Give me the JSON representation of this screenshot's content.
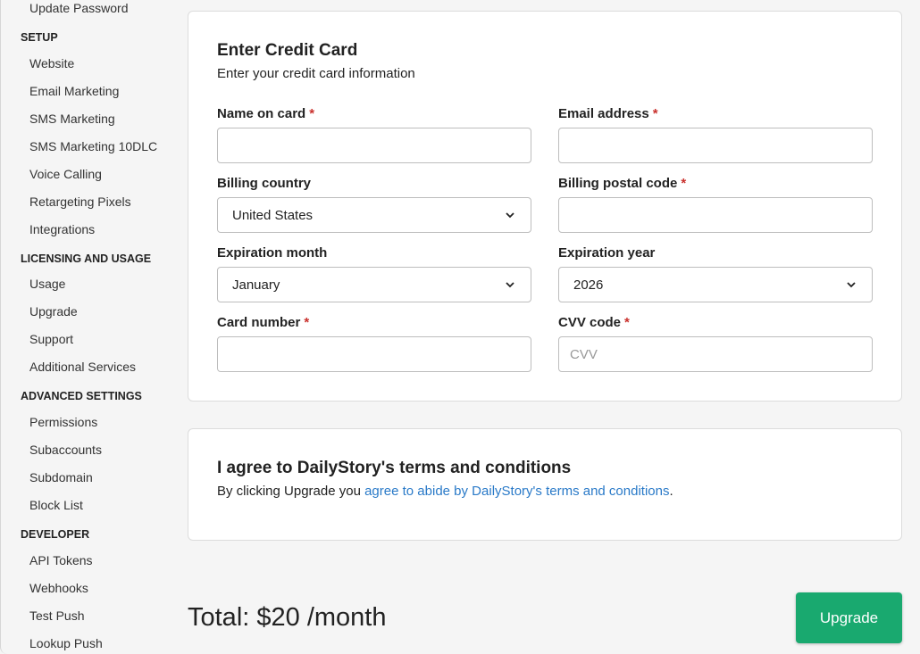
{
  "sidebar": {
    "top_item": "Update Password",
    "sections": [
      {
        "title": "SETUP",
        "items": [
          "Website",
          "Email Marketing",
          "SMS Marketing",
          "SMS Marketing 10DLC",
          "Voice Calling",
          "Retargeting Pixels",
          "Integrations"
        ]
      },
      {
        "title": "LICENSING AND USAGE",
        "items": [
          "Usage",
          "Upgrade",
          "Support",
          "Additional Services"
        ]
      },
      {
        "title": "ADVANCED SETTINGS",
        "items": [
          "Permissions",
          "Subaccounts",
          "Subdomain",
          "Block List"
        ]
      },
      {
        "title": "DEVELOPER",
        "items": [
          "API Tokens",
          "Webhooks",
          "Test Push",
          "Lookup Push"
        ]
      }
    ]
  },
  "credit_card": {
    "title": "Enter Credit Card",
    "subtitle": "Enter your credit card information",
    "required_mark": "*",
    "name_label": "Name on card",
    "name_value": "",
    "email_label": "Email address",
    "email_value": "",
    "country_label": "Billing country",
    "country_value": "United States",
    "postal_label": "Billing postal code",
    "postal_value": "",
    "exp_month_label": "Expiration month",
    "exp_month_value": "January",
    "exp_year_label": "Expiration year",
    "exp_year_value": "2026",
    "card_number_label": "Card number",
    "card_number_value": "",
    "cvv_label": "CVV code",
    "cvv_placeholder": "CVV"
  },
  "terms": {
    "title": "I agree to DailyStory's terms and conditions",
    "text_prefix": "By clicking Upgrade you ",
    "link_text": "agree to abide by DailyStory's terms and conditions",
    "text_suffix": "."
  },
  "footer": {
    "total": "Total: $20 /month",
    "upgrade_label": "Upgrade"
  },
  "colors": {
    "accent_green": "#19a96f",
    "link_blue": "#2a7ac8",
    "required_red": "#c9302c"
  }
}
